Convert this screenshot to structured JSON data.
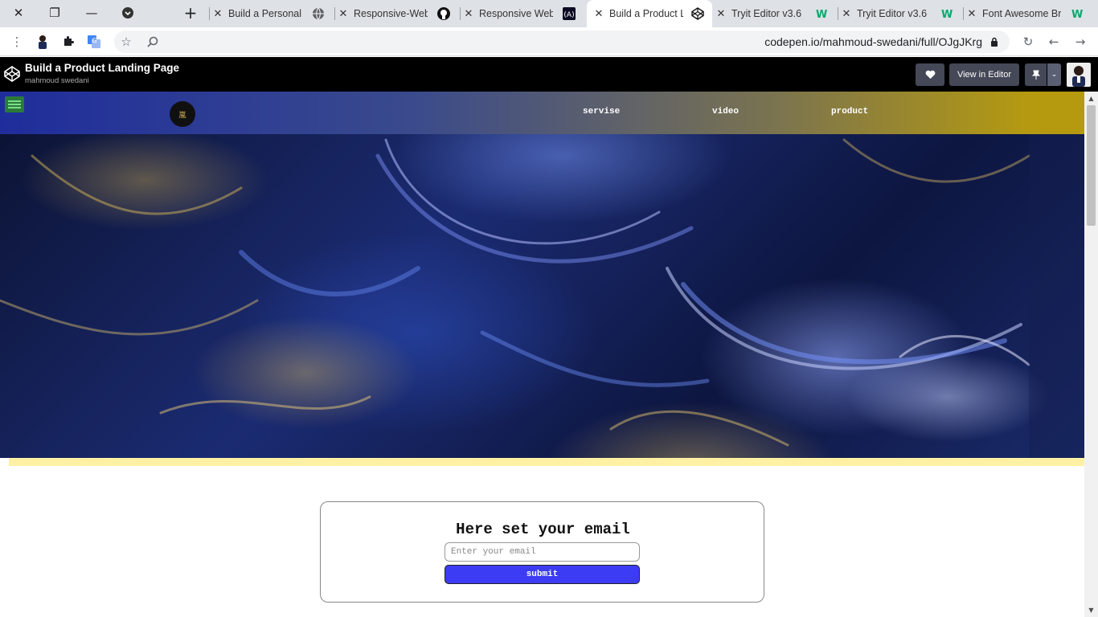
{
  "browser": {
    "tabs": [
      {
        "title": "Build a Personal P",
        "favicon": "globe-icon"
      },
      {
        "title": "Responsive-Web-",
        "favicon": "github-icon"
      },
      {
        "title": "Responsive Web D",
        "favicon": "freecodecamp-icon"
      },
      {
        "title": "Build a Product La",
        "favicon": "codepen-icon",
        "active": true
      },
      {
        "title": "Tryit Editor v3.6",
        "favicon": "w3schools-icon"
      },
      {
        "title": "Tryit Editor v3.6",
        "favicon": "w3schools-icon"
      },
      {
        "title": "Font Awesome Br",
        "favicon": "w3schools-icon"
      }
    ],
    "url": "codepen.io/mahmoud-swedani/full/OJgJKrg"
  },
  "codepen": {
    "title": "Build a Product Landing Page",
    "author": "mahmoud swedani",
    "view_in_editor": "View in Editor"
  },
  "page": {
    "brand_logo_text": "嵐",
    "nav": [
      "servise",
      "video",
      "product"
    ],
    "email": {
      "heading": "Here set your email",
      "placeholder": "Enter your email",
      "submit": "submit"
    }
  },
  "colors": {
    "navbar_start": "#1f2d9c",
    "navbar_end": "#b59a10",
    "submit_bg": "#3c3cf5",
    "yellow_bar": "#fef1a3"
  }
}
